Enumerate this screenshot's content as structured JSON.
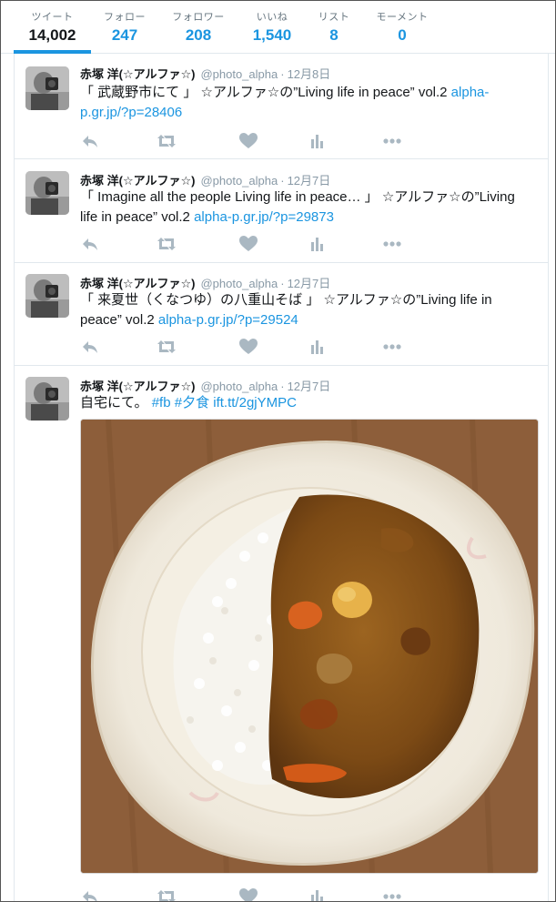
{
  "nav": [
    {
      "label": "ツイート",
      "value": "14,002"
    },
    {
      "label": "フォロー",
      "value": "247"
    },
    {
      "label": "フォロワー",
      "value": "208"
    },
    {
      "label": "いいね",
      "value": "1,540"
    },
    {
      "label": "リスト",
      "value": "8"
    },
    {
      "label": "モーメント",
      "value": "0"
    }
  ],
  "tweets": [
    {
      "fullname": "赤塚 洋(☆アルファ☆)",
      "username": "@photo_alpha",
      "time": "12月8日",
      "text": "「 武蔵野市にて 」 ☆アルファ☆の”Living life in peace” vol.2 ",
      "link": "alpha-p.gr.jp/?p=28406"
    },
    {
      "fullname": "赤塚 洋(☆アルファ☆)",
      "username": "@photo_alpha",
      "time": "12月7日",
      "text": "「 Imagine all the people Living life in peace… 」 ☆アルファ☆の”Living life in peace” vol.2 ",
      "link": "alpha-p.gr.jp/?p=29873"
    },
    {
      "fullname": "赤塚 洋(☆アルファ☆)",
      "username": "@photo_alpha",
      "time": "12月7日",
      "text": "「 来夏世（くなつゆ）の八重山そば 」 ☆アルファ☆の”Living life in peace” vol.2 ",
      "link": "alpha-p.gr.jp/?p=29524"
    },
    {
      "fullname": "赤塚 洋(☆アルファ☆)",
      "username": "@photo_alpha",
      "time": "12月7日",
      "text": "自宅にて。 ",
      "hashtag1": "#fb",
      "hashtag2": "#夕食",
      "link": "ift.tt/2gjYMPC"
    }
  ],
  "separator": "·",
  "colors": {
    "link": "#1b95e0",
    "icon": "#aab8c2",
    "border": "#e1e8ed"
  },
  "icons": [
    "reply-icon",
    "retweet-icon",
    "like-icon",
    "analytics-icon",
    "more-icon"
  ]
}
